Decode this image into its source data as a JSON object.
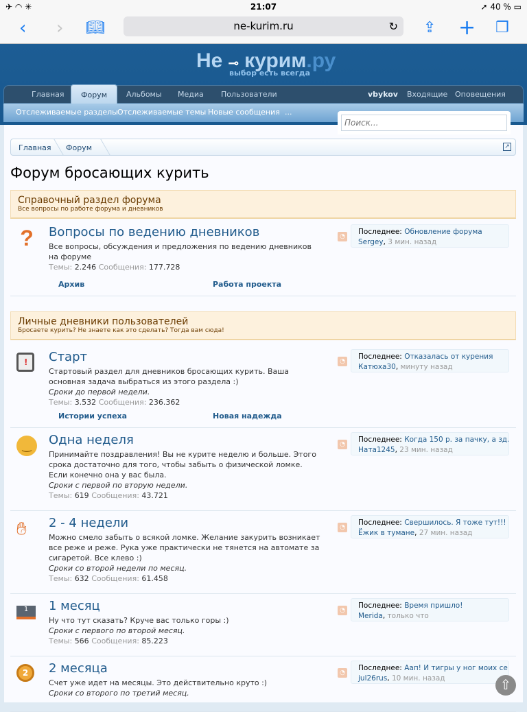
{
  "status": {
    "time": "21:07",
    "battery": "40 %"
  },
  "browser": {
    "url": "ne-kurim.ru"
  },
  "site": {
    "logo": "Не курим.ру",
    "logo_a": "Не",
    "logo_b": "курим",
    "logo_c": ".ру",
    "slogan": "выбор есть всегда"
  },
  "nav": {
    "tabs": [
      "Главная",
      "Форум",
      "Альбомы",
      "Медиа",
      "Пользователи"
    ],
    "user": "vbykov",
    "inbox": "Входящие",
    "alerts": "Оповещения"
  },
  "subnav": [
    "Отслеживаемые разделы",
    "Отслеживаемые темы",
    "Новые сообщения",
    "..."
  ],
  "search": {
    "placeholder": "Поиск..."
  },
  "breadcrumb": [
    "Главная",
    "Форум"
  ],
  "page_title": "Форум бросающих курить",
  "labels": {
    "themes": "Темы:",
    "messages": "Сообщения:",
    "last": "Последнее:"
  },
  "categories": [
    {
      "title": "Справочный раздел форума",
      "desc": "Все вопросы по работе форума и дневников"
    },
    {
      "title": "Личные дневники пользователей",
      "desc": "Бросаете курить? Не знаете как это сделать? Тогда вам сюда!"
    }
  ],
  "forums": [
    {
      "title": "Вопросы по ведению дневников",
      "icon": "question-icon",
      "desc": "Все вопросы, обсуждения и предложения по ведению дневников на форуме",
      "note": "",
      "themes": "2.246",
      "messages": "177.728",
      "subforums": [
        "Архив",
        "Работа проекта"
      ],
      "last_title": "Обновление форума",
      "last_user": "Sergey",
      "last_time": "3 мин. назад"
    },
    {
      "title": "Старт",
      "icon": "calendar-icon",
      "desc": "Стартовый раздел для дневников бросающих курить. Ваша основная задача выбраться из этого раздела :)",
      "note": "Сроки до первой недели.",
      "themes": "3.532",
      "messages": "236.362",
      "subforums": [
        "Истории успеха",
        "Новая надежда"
      ],
      "last_title": "Отказалась от курения",
      "last_user": "Катюха30",
      "last_time": "минуту назад"
    },
    {
      "title": "Одна неделя",
      "icon": "smiley-icon",
      "desc": "Принимайте поздравления! Вы не курите неделю и больше. Этого срока достаточно для того, чтобы забыть о физической ломке. Если конечно она у вас была.",
      "note": "Сроки с первой по вторую недели.",
      "themes": "619",
      "messages": "43.721",
      "subforums": [],
      "last_title": "Когда 150 р. за пачку, а зд...",
      "last_user": "Ната1245",
      "last_time": "23 мин. назад"
    },
    {
      "title": "2 - 4 недели",
      "icon": "hand-icon",
      "desc": "Можно смело забыть о всякой ломке. Желание закурить возникает все реже и реже. Рука уже практически не тянется на автомате за сигаретой. Все клево :)",
      "note": "Сроки со второй недели по месяц.",
      "themes": "632",
      "messages": "61.458",
      "subforums": [],
      "last_title": "Свершилось. Я тоже тут!!!",
      "last_user": "Ёжик в тумане",
      "last_time": "27 мин. назад"
    },
    {
      "title": "1 месяц",
      "icon": "podium-icon",
      "desc": "Ну что тут сказать? Круче вас только горы :)",
      "note": "Сроки с первого по второй месяц.",
      "themes": "566",
      "messages": "85.223",
      "subforums": [],
      "last_title": "Время пришло!",
      "last_user": "Merida",
      "last_time": "только что"
    },
    {
      "title": "2 месяца",
      "icon": "medal-icon",
      "desc": "Счет уже идет на месяцы. Это действительно круто :)",
      "note": "Сроки со второго по третий месяц.",
      "themes": "",
      "messages": "",
      "subforums": [],
      "last_title": "Аап! И тигры у ног моих се...",
      "last_user": "jul26rus",
      "last_time": "10 мин. назад"
    }
  ]
}
